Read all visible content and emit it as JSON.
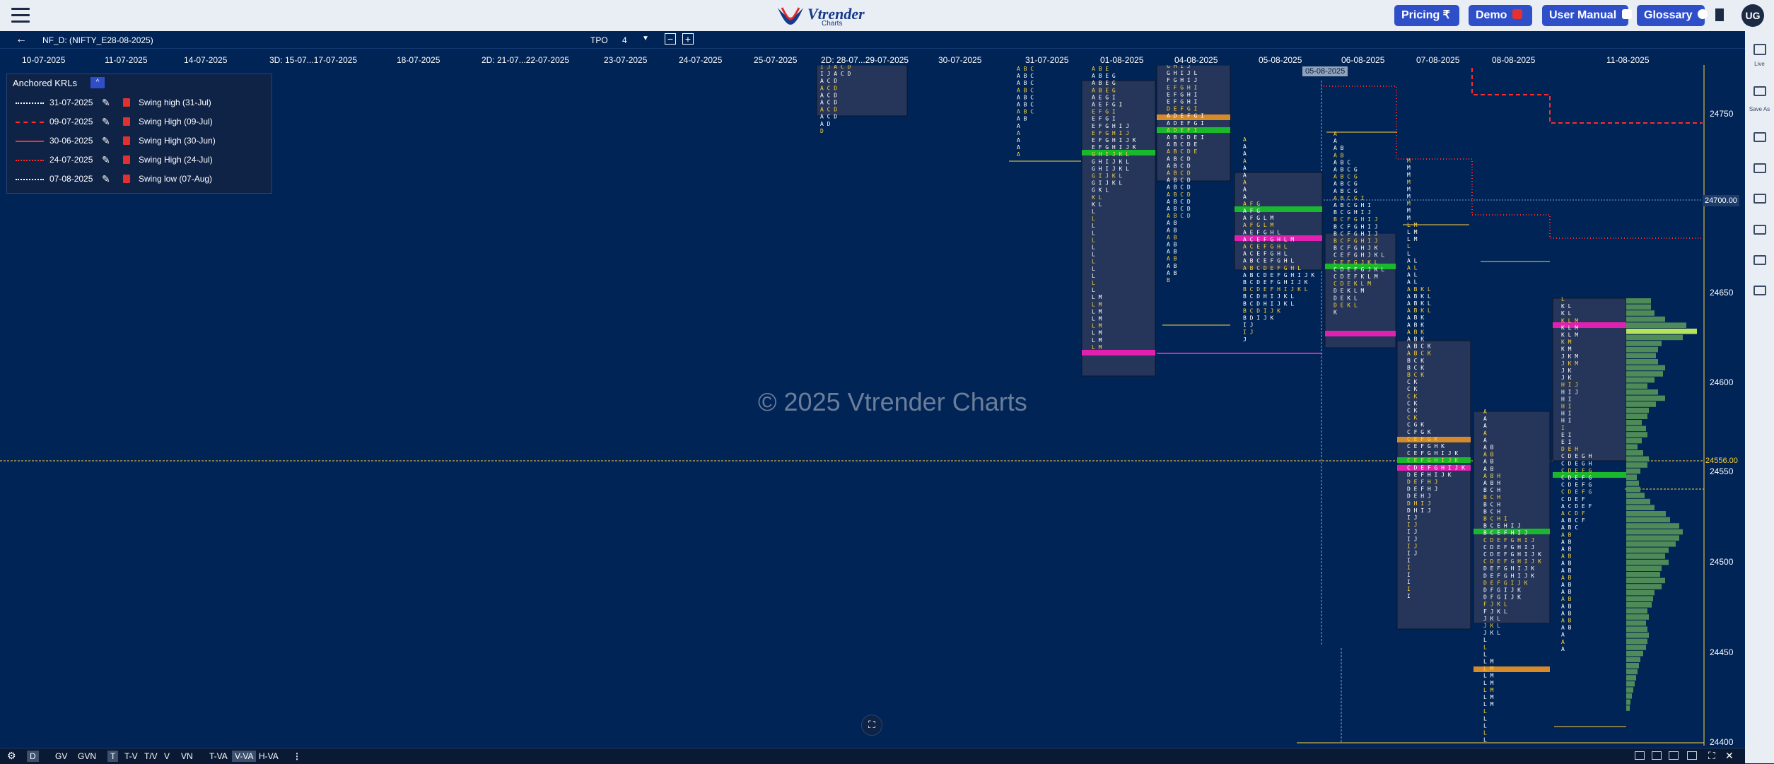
{
  "header": {
    "logo_text": "Vtrender",
    "logo_sub": "Charts",
    "buttons": [
      {
        "label": "Pricing ₹"
      },
      {
        "label": "Demo"
      },
      {
        "label": "User Manual"
      },
      {
        "label": "Glossary"
      }
    ],
    "user_initials": "UG"
  },
  "toolbar": {
    "symbol": "NF_D: (NIFTY_E28-08-2025)",
    "tpo_label": "TPO",
    "tpo_value": "4",
    "minus": "−",
    "plus": "+"
  },
  "dates": [
    "10-07-2025",
    "11-07-2025",
    "14-07-2025",
    "3D: 15-07...17-07-2025",
    "18-07-2025",
    "2D: 21-07...22-07-2025",
    "23-07-2025",
    "24-07-2025",
    "25-07-2025",
    "2D: 28-07...29-07-2025",
    "30-07-2025",
    "31-07-2025",
    "01-08-2025",
    "04-08-2025",
    "05-08-2025",
    "06-08-2025",
    "07-08-2025",
    "08-08-2025",
    "11-08-2025"
  ],
  "price_axis": {
    "ticks": [
      "24750",
      "24650",
      "24600",
      "24550",
      "24500",
      "24450",
      "24400"
    ],
    "marker_white": "24700.00",
    "marker_yellow": "24556.00"
  },
  "date_chip": "05-08-2025",
  "watermark": "© 2025 Vtrender Charts",
  "legend": {
    "title": "Anchored KRLs",
    "toggle": "^",
    "items": [
      {
        "date": "31-07-2025",
        "name": "Swing high (31-Jul)",
        "color": "#ffffff",
        "style": "dotted"
      },
      {
        "date": "09-07-2025",
        "name": "Swing High (09-Jul)",
        "color": "#ff2a2a",
        "style": "dashed"
      },
      {
        "date": "30-06-2025",
        "name": "Swing High (30-Jun)",
        "color": "#ff2a2a",
        "style": "solid"
      },
      {
        "date": "24-07-2025",
        "name": "Swing High (24-Jul)",
        "color": "#ff2a2a",
        "style": "dotted"
      },
      {
        "date": "07-08-2025",
        "name": "Swing low (07-Aug)",
        "color": "#ffffff",
        "style": "dotted"
      }
    ]
  },
  "sidebar": {
    "items": [
      {
        "label": "Live"
      },
      {
        "label": "Save As"
      }
    ]
  },
  "bottom_bar": {
    "buttons": [
      "D",
      "GV",
      "GVN",
      "T",
      "T-V",
      "T/V",
      "V",
      "VN",
      "T-VA",
      "V-VA",
      "H-VA"
    ],
    "active": [
      "D",
      "V-VA"
    ],
    "more": "⋮"
  },
  "colors": {
    "background": "#002456",
    "tpo_yellow": "#ffd23c",
    "tpo_white": "#ffffff",
    "poc_magenta": "#e020b0",
    "va_green": "#19b82d",
    "orange": "#d68a2a",
    "krl_red": "#ff2a2a"
  },
  "profiles": [
    {
      "id": "p-2807",
      "letters": [
        "I J A C D",
        "I J A C D",
        "A C D",
        "A C D",
        "A C D",
        "A C D",
        "A C D",
        "A C D",
        "A D",
        "D"
      ]
    },
    {
      "id": "p-3107",
      "letters": [
        "A B C",
        "A B C",
        "A B C",
        "A B C",
        "A B C",
        "A B C",
        "A B C",
        "A B",
        "A",
        "A",
        "A",
        "A",
        "A"
      ]
    },
    {
      "id": "p-0108",
      "letters": [
        "A B E",
        "A B E G",
        "A B E G",
        "A B E G",
        "A E G I",
        "A E F G I",
        "E F G I",
        "E F G I",
        "E F G H I J",
        "E F G H I J",
        "E F G H I J K",
        "E F G H I J K",
        "G H I J K L",
        "G H I J K L",
        "G H I J K L",
        "G I J K L",
        "G I J K L",
        "G K L",
        "K L",
        "K L",
        "L",
        "L",
        "L",
        "L",
        "L",
        "L",
        "L",
        "L",
        "L",
        "L",
        "L",
        "L",
        "L M",
        "L M",
        "L M",
        "L M",
        "L M",
        "L M",
        "L M",
        "L M"
      ]
    },
    {
      "id": "p-0408",
      "letters": [
        "G H I J",
        "G H I J L",
        "F G H I J",
        "E F G H I",
        "E F G H I",
        "E F G H I",
        "D E F G I",
        "A D E F G I",
        "A D E F G I",
        "A D E F I",
        "A B C D E I",
        "A B C D E",
        "A B C D E",
        "A B C D",
        "A B C D",
        "A B C D",
        "A B C D",
        "A B C D",
        "A B C D",
        "A B C D",
        "A B C D",
        "A B C D",
        "A B",
        "A B",
        "A B",
        "A B",
        "A B",
        "A B",
        "A B",
        "A B",
        "B"
      ]
    },
    {
      "id": "p-0508",
      "letters": [
        "A",
        "A",
        "A",
        "A",
        "A",
        "A",
        "A",
        "A",
        "A",
        "A F G",
        "A F G",
        "A F G L M",
        "A F G L M",
        "A E F G H L",
        "A C E F G H L M",
        "A C E F G H L",
        "A C E F G H L",
        "A B C E F G H L",
        "A B C D E F G H L",
        "A B C D E F G H I J K",
        "B C D E F G H I J K",
        "B C D E F H I J K L",
        "B C D H I J K L",
        "B C D H I J K L",
        "B C D I J K",
        "B D I J K",
        "I J",
        "I J",
        "J"
      ]
    },
    {
      "id": "p-0608",
      "letters": [
        "A",
        "A",
        "A B",
        "A B",
        "A B C",
        "A B C G",
        "A B C G",
        "A B C G",
        "A B C G",
        "A B C G I",
        "A B C G H I",
        "B C G H I J",
        "B C F G H I J",
        "B C F G H I J",
        "B C F G H I J",
        "B C F G H I J",
        "B C F G H J K",
        "C E F G H J K L",
        "C E F G J K L",
        "C D E F G J K L",
        "C D E F K L M",
        "C D E K L M",
        "D E K L M",
        "D E K L",
        "D E K L",
        "K"
      ]
    },
    {
      "id": "p-0708",
      "letters": [
        "M",
        "M",
        "M",
        "M",
        "M",
        "M",
        "M",
        "M",
        "M",
        "L M",
        "L M",
        "L M",
        "L",
        "L",
        "A L",
        "A L",
        "A L",
        "A L",
        "A B K L",
        "A B K L",
        "A B K L",
        "A B K L",
        "A B K",
        "A B K",
        "A B K",
        "A B K",
        "A B C K",
        "A B C K",
        "B C K",
        "B C K",
        "B C K",
        "C K",
        "C K",
        "C K",
        "C K",
        "C K",
        "C K",
        "C G K",
        "C F G K",
        "C E F G K",
        "C E F G H K",
        "C E F G H I J K",
        "C E F G H I J K",
        "C D E F G H I J K",
        "D E F H I J K",
        "D E F H J",
        "D E F H J",
        "D E H J",
        "D H I J",
        "D H I J",
        "I J",
        "I J",
        "I J",
        "I J",
        "I J",
        "I J",
        "I",
        "I",
        "I",
        "I",
        "I",
        "I"
      ]
    },
    {
      "id": "p-0808",
      "letters": [
        "A",
        "A",
        "A",
        "A",
        "A",
        "A B",
        "A B",
        "A B",
        "A B",
        "A B H",
        "A B H",
        "B C H",
        "B C H",
        "B C H",
        "B C H",
        "B C H I",
        "B C E H I J",
        "B C E F H I J",
        "C D E F G H I J",
        "C D E F G H I J",
        "C D E F G H I J K",
        "C D E F G H I J K",
        "D E F G H I J K",
        "D E F G H I J K",
        "D E F G I J K",
        "D F G I J K",
        "D F G I J K",
        "F J K L",
        "F J K L",
        "J K L",
        "J K L",
        "J K L",
        "L",
        "L",
        "L",
        "L M",
        "L M",
        "L M",
        "L M",
        "L M",
        "L M",
        "L M",
        "L",
        "L",
        "L",
        "L",
        "L"
      ]
    },
    {
      "id": "p-1108",
      "letters": [
        "L",
        "K L",
        "K L",
        "K L M",
        "K L M",
        "K L M",
        "K M",
        "K M",
        "J K M",
        "J K M",
        "J K",
        "J K",
        "H I J",
        "H I J",
        "H I",
        "H I",
        "H I",
        "H I",
        "I",
        "E I",
        "E I",
        "D E H",
        "C D E G H",
        "C D E G H",
        "C D E F G",
        "C D E F G",
        "C D E F G",
        "C D E F G",
        "C D E F",
        "A C D E F",
        "A C D F",
        "A B C F",
        "A B C",
        "A B",
        "A B",
        "A B",
        "A B",
        "A B",
        "A B",
        "A B",
        "A B",
        "A B",
        "A B",
        "A B",
        "A B",
        "A B",
        "A B",
        "A",
        "A",
        "A"
      ]
    }
  ],
  "volume_profile": [
    {
      "v": 0.35
    },
    {
      "v": 0.35
    },
    {
      "v": 0.4
    },
    {
      "v": 0.55
    },
    {
      "v": 0.85
    },
    {
      "v": 1.0
    },
    {
      "v": 0.8
    },
    {
      "v": 0.5
    },
    {
      "v": 0.45
    },
    {
      "v": 0.42
    },
    {
      "v": 0.45
    },
    {
      "v": 0.55
    },
    {
      "v": 0.52
    },
    {
      "v": 0.4
    },
    {
      "v": 0.3
    },
    {
      "v": 0.45
    },
    {
      "v": 0.55
    },
    {
      "v": 0.42
    },
    {
      "v": 0.32
    },
    {
      "v": 0.3
    },
    {
      "v": 0.22
    },
    {
      "v": 0.28
    },
    {
      "v": 0.3
    },
    {
      "v": 0.22
    },
    {
      "v": 0.16
    },
    {
      "v": 0.24
    },
    {
      "v": 0.32
    },
    {
      "v": 0.3
    },
    {
      "v": 0.2
    },
    {
      "v": 0.15
    },
    {
      "v": 0.18
    },
    {
      "v": 0.2
    },
    {
      "v": 0.26
    },
    {
      "v": 0.34
    },
    {
      "v": 0.4
    },
    {
      "v": 0.56
    },
    {
      "v": 0.62
    },
    {
      "v": 0.75
    },
    {
      "v": 0.8
    },
    {
      "v": 0.75
    },
    {
      "v": 0.7
    },
    {
      "v": 0.6
    },
    {
      "v": 0.55
    },
    {
      "v": 0.6
    },
    {
      "v": 0.5
    },
    {
      "v": 0.48
    },
    {
      "v": 0.55
    },
    {
      "v": 0.5
    },
    {
      "v": 0.4
    },
    {
      "v": 0.38
    },
    {
      "v": 0.36
    },
    {
      "v": 0.3
    },
    {
      "v": 0.32
    },
    {
      "v": 0.28
    },
    {
      "v": 0.3
    },
    {
      "v": 0.32
    },
    {
      "v": 0.3
    },
    {
      "v": 0.28
    },
    {
      "v": 0.24
    },
    {
      "v": 0.2
    },
    {
      "v": 0.18
    },
    {
      "v": 0.16
    },
    {
      "v": 0.14
    },
    {
      "v": 0.12
    },
    {
      "v": 0.1
    },
    {
      "v": 0.08
    },
    {
      "v": 0.06
    },
    {
      "v": 0.05
    }
  ]
}
